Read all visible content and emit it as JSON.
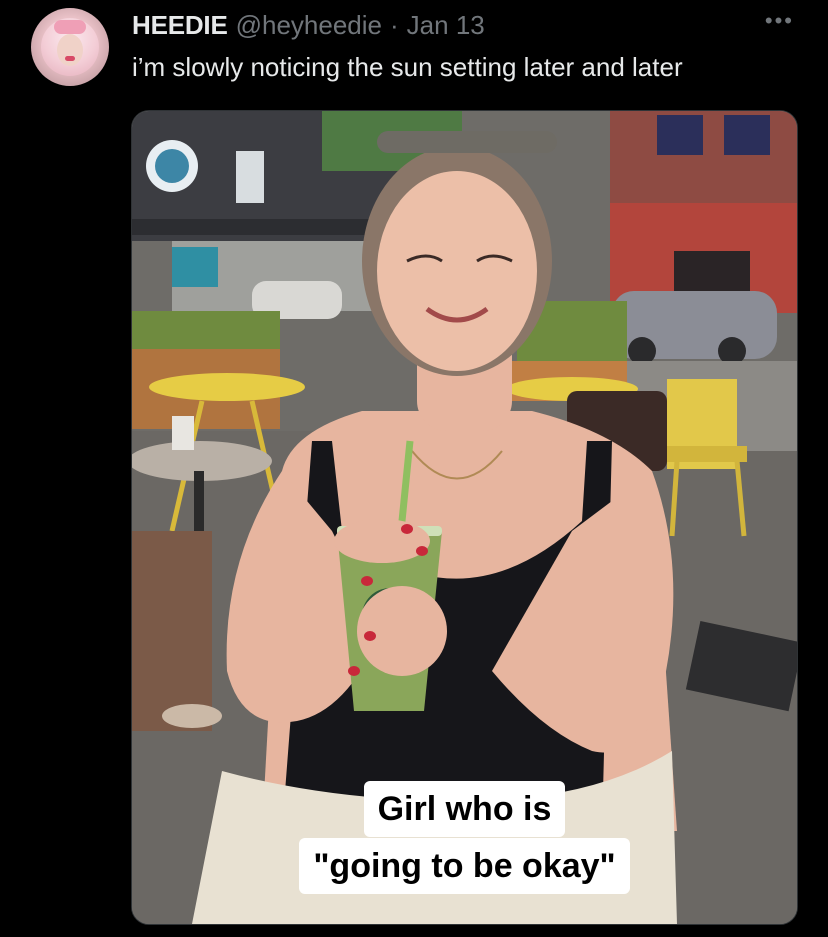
{
  "tweet": {
    "display_name": "HEEDIE",
    "handle": "@heyheedie",
    "separator": "·",
    "date": "Jan 13",
    "text": "i’m slowly noticing the sun setting later and later",
    "more_icon": "more-options-icon"
  },
  "media": {
    "caption_line_1": "Girl who is",
    "caption_line_2": "\"going to be okay\""
  },
  "colors": {
    "background": "#000000",
    "primary_text": "#e7e9ea",
    "secondary_text": "#71767b"
  }
}
